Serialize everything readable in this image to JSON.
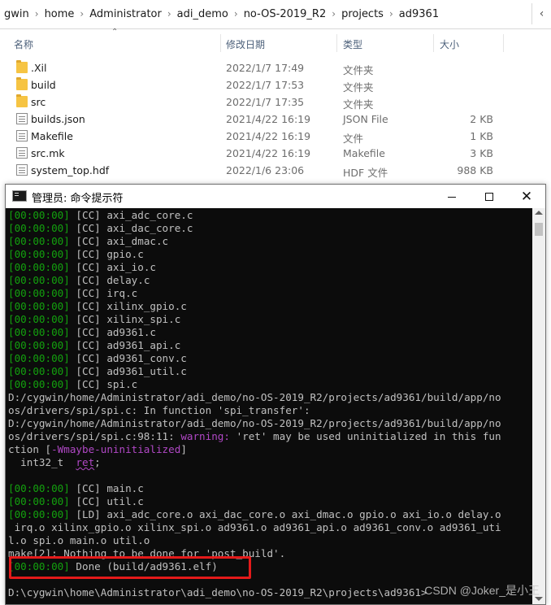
{
  "explorer": {
    "breadcrumb": [
      "gwin",
      "home",
      "Administrator",
      "adi_demo",
      "no-OS-2019_R2",
      "projects",
      "ad9361"
    ],
    "breadcrumb_separator": "›",
    "addr_tail": "‹",
    "headers": {
      "name": "名称",
      "date": "修改日期",
      "type": "类型",
      "size": "大小"
    },
    "files": [
      {
        "name": ".Xil",
        "date": "2022/1/7 17:49",
        "type": "文件夹",
        "size": "",
        "icon": "folder-icon"
      },
      {
        "name": "build",
        "date": "2022/1/7 17:53",
        "type": "文件夹",
        "size": "",
        "icon": "folder-icon"
      },
      {
        "name": "src",
        "date": "2022/1/7 17:35",
        "type": "文件夹",
        "size": "",
        "icon": "folder-icon"
      },
      {
        "name": "builds.json",
        "date": "2021/4/22 16:19",
        "type": "JSON File",
        "size": "2 KB",
        "icon": "json-file-icon"
      },
      {
        "name": "Makefile",
        "date": "2021/4/22 16:19",
        "type": "文件",
        "size": "1 KB",
        "icon": "file-icon"
      },
      {
        "name": "src.mk",
        "date": "2021/4/22 16:19",
        "type": "Makefile",
        "size": "3 KB",
        "icon": "makefile-icon"
      },
      {
        "name": "system_top.hdf",
        "date": "2022/1/6 23:06",
        "type": "HDF 文件",
        "size": "988 KB",
        "icon": "file-icon"
      }
    ]
  },
  "console": {
    "title": "管理员: 命令提示符",
    "buttons": {
      "minimize": "—",
      "maximize": "□",
      "close": "✕"
    },
    "lines": [
      [
        [
          "g",
          "[00:00:00]"
        ],
        [
          "w",
          " [CC] axi_adc_core.c"
        ]
      ],
      [
        [
          "g",
          "[00:00:00]"
        ],
        [
          "w",
          " [CC] axi_dac_core.c"
        ]
      ],
      [
        [
          "g",
          "[00:00:00]"
        ],
        [
          "w",
          " [CC] axi_dmac.c"
        ]
      ],
      [
        [
          "g",
          "[00:00:00]"
        ],
        [
          "w",
          " [CC] gpio.c"
        ]
      ],
      [
        [
          "g",
          "[00:00:00]"
        ],
        [
          "w",
          " [CC] axi_io.c"
        ]
      ],
      [
        [
          "g",
          "[00:00:00]"
        ],
        [
          "w",
          " [CC] delay.c"
        ]
      ],
      [
        [
          "g",
          "[00:00:00]"
        ],
        [
          "w",
          " [CC] irq.c"
        ]
      ],
      [
        [
          "g",
          "[00:00:00]"
        ],
        [
          "w",
          " [CC] xilinx_gpio.c"
        ]
      ],
      [
        [
          "g",
          "[00:00:00]"
        ],
        [
          "w",
          " [CC] xilinx_spi.c"
        ]
      ],
      [
        [
          "g",
          "[00:00:00]"
        ],
        [
          "w",
          " [CC] ad9361.c"
        ]
      ],
      [
        [
          "g",
          "[00:00:00]"
        ],
        [
          "w",
          " [CC] ad9361_api.c"
        ]
      ],
      [
        [
          "g",
          "[00:00:00]"
        ],
        [
          "w",
          " [CC] ad9361_conv.c"
        ]
      ],
      [
        [
          "g",
          "[00:00:00]"
        ],
        [
          "w",
          " [CC] ad9361_util.c"
        ]
      ],
      [
        [
          "g",
          "[00:00:00]"
        ],
        [
          "w",
          " [CC] spi.c"
        ]
      ],
      [
        [
          "w",
          "D:/cygwin/home/Administrator/adi_demo/no-OS-2019_R2/projects/ad9361/build/app/no"
        ]
      ],
      [
        [
          "w",
          "os/drivers/spi/spi.c: In function 'spi_transfer':"
        ]
      ],
      [
        [
          "w",
          "D:/cygwin/home/Administrator/adi_demo/no-OS-2019_R2/projects/ad9361/build/app/no"
        ]
      ],
      [
        [
          "w",
          "os/drivers/spi/spi.c:98:11: "
        ],
        [
          "m",
          "warning: "
        ],
        [
          "w",
          "'ret' may be used uninitialized in this fun"
        ]
      ],
      [
        [
          "w",
          "ction ["
        ],
        [
          "m",
          "-Wmaybe-uninitialized"
        ],
        [
          "w",
          "]"
        ]
      ],
      [
        [
          "w",
          "  int32_t  "
        ],
        [
          "mu",
          "ret"
        ],
        [
          "w",
          ";"
        ]
      ],
      [
        [
          "w",
          " "
        ]
      ],
      [
        [
          "g",
          "[00:00:00]"
        ],
        [
          "w",
          " [CC] main.c"
        ]
      ],
      [
        [
          "g",
          "[00:00:00]"
        ],
        [
          "w",
          " [CC] util.c"
        ]
      ],
      [
        [
          "g",
          "[00:00:00]"
        ],
        [
          "w",
          " [LD] axi_adc_core.o axi_dac_core.o axi_dmac.o gpio.o axi_io.o delay.o"
        ]
      ],
      [
        [
          "w",
          " irq.o xilinx_gpio.o xilinx_spi.o ad9361.o ad9361_api.o ad9361_conv.o ad9361_uti"
        ]
      ],
      [
        [
          "w",
          "l.o spi.o main.o util.o"
        ]
      ],
      [
        [
          "w",
          "make[2]: Nothing to be done for 'post_build'."
        ]
      ],
      [
        [
          "g",
          "[00:00:00]"
        ],
        [
          "w",
          " Done (build/ad9361.elf)"
        ]
      ],
      [
        [
          "w",
          " "
        ]
      ],
      [
        [
          "w",
          "D:\\cygwin\\home\\Administrator\\adi_demo\\no-OS-2019_R2\\projects\\ad9361>"
        ]
      ]
    ]
  },
  "watermark": "CSDN @Joker_是小王",
  "colors": {
    "terminal_bg": "#0c0c0c",
    "terminal_fg": "#c0c0c0",
    "timestamp_green": "#13a10e",
    "warning_magenta": "#b148c6",
    "highlight_red": "#e41a1a",
    "folder_yellow": "#f6c443"
  }
}
